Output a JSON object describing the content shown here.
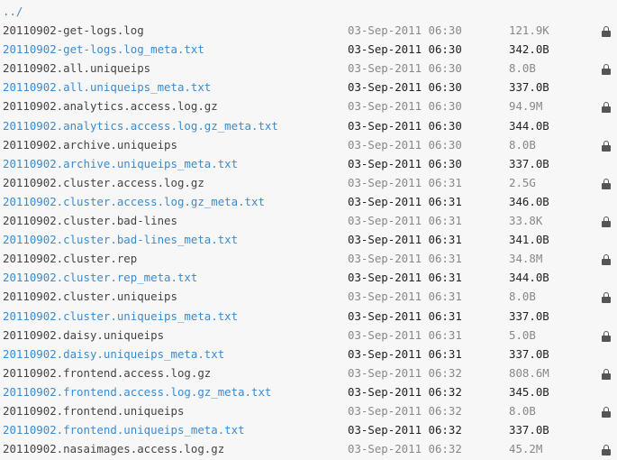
{
  "parent_link": "../",
  "files": [
    {
      "name": "20110902-get-logs.log",
      "date": "03-Sep-2011 06:30",
      "size": "121.9K",
      "locked": true,
      "link": false
    },
    {
      "name": "20110902-get-logs.log_meta.txt",
      "date": "03-Sep-2011 06:30",
      "size": "342.0B",
      "locked": false,
      "link": true
    },
    {
      "name": "20110902.all.uniqueips",
      "date": "03-Sep-2011 06:30",
      "size": "8.0B",
      "locked": true,
      "link": false
    },
    {
      "name": "20110902.all.uniqueips_meta.txt",
      "date": "03-Sep-2011 06:30",
      "size": "337.0B",
      "locked": false,
      "link": true
    },
    {
      "name": "20110902.analytics.access.log.gz",
      "date": "03-Sep-2011 06:30",
      "size": "94.9M",
      "locked": true,
      "link": false
    },
    {
      "name": "20110902.analytics.access.log.gz_meta.txt",
      "date": "03-Sep-2011 06:30",
      "size": "344.0B",
      "locked": false,
      "link": true
    },
    {
      "name": "20110902.archive.uniqueips",
      "date": "03-Sep-2011 06:30",
      "size": "8.0B",
      "locked": true,
      "link": false
    },
    {
      "name": "20110902.archive.uniqueips_meta.txt",
      "date": "03-Sep-2011 06:30",
      "size": "337.0B",
      "locked": false,
      "link": true
    },
    {
      "name": "20110902.cluster.access.log.gz",
      "date": "03-Sep-2011 06:31",
      "size": "2.5G",
      "locked": true,
      "link": false
    },
    {
      "name": "20110902.cluster.access.log.gz_meta.txt",
      "date": "03-Sep-2011 06:31",
      "size": "346.0B",
      "locked": false,
      "link": true
    },
    {
      "name": "20110902.cluster.bad-lines",
      "date": "03-Sep-2011 06:31",
      "size": "33.8K",
      "locked": true,
      "link": false
    },
    {
      "name": "20110902.cluster.bad-lines_meta.txt",
      "date": "03-Sep-2011 06:31",
      "size": "341.0B",
      "locked": false,
      "link": true
    },
    {
      "name": "20110902.cluster.rep",
      "date": "03-Sep-2011 06:31",
      "size": "34.8M",
      "locked": true,
      "link": false
    },
    {
      "name": "20110902.cluster.rep_meta.txt",
      "date": "03-Sep-2011 06:31",
      "size": "344.0B",
      "locked": false,
      "link": true
    },
    {
      "name": "20110902.cluster.uniqueips",
      "date": "03-Sep-2011 06:31",
      "size": "8.0B",
      "locked": true,
      "link": false
    },
    {
      "name": "20110902.cluster.uniqueips_meta.txt",
      "date": "03-Sep-2011 06:31",
      "size": "337.0B",
      "locked": false,
      "link": true
    },
    {
      "name": "20110902.daisy.uniqueips",
      "date": "03-Sep-2011 06:31",
      "size": "5.0B",
      "locked": true,
      "link": false
    },
    {
      "name": "20110902.daisy.uniqueips_meta.txt",
      "date": "03-Sep-2011 06:31",
      "size": "337.0B",
      "locked": false,
      "link": true
    },
    {
      "name": "20110902.frontend.access.log.gz",
      "date": "03-Sep-2011 06:32",
      "size": "808.6M",
      "locked": true,
      "link": false
    },
    {
      "name": "20110902.frontend.access.log.gz_meta.txt",
      "date": "03-Sep-2011 06:32",
      "size": "345.0B",
      "locked": false,
      "link": true
    },
    {
      "name": "20110902.frontend.uniqueips",
      "date": "03-Sep-2011 06:32",
      "size": "8.0B",
      "locked": true,
      "link": false
    },
    {
      "name": "20110902.frontend.uniqueips_meta.txt",
      "date": "03-Sep-2011 06:32",
      "size": "337.0B",
      "locked": false,
      "link": true
    },
    {
      "name": "20110902.nasaimages.access.log.gz",
      "date": "03-Sep-2011 06:32",
      "size": "45.2M",
      "locked": true,
      "link": false
    }
  ]
}
